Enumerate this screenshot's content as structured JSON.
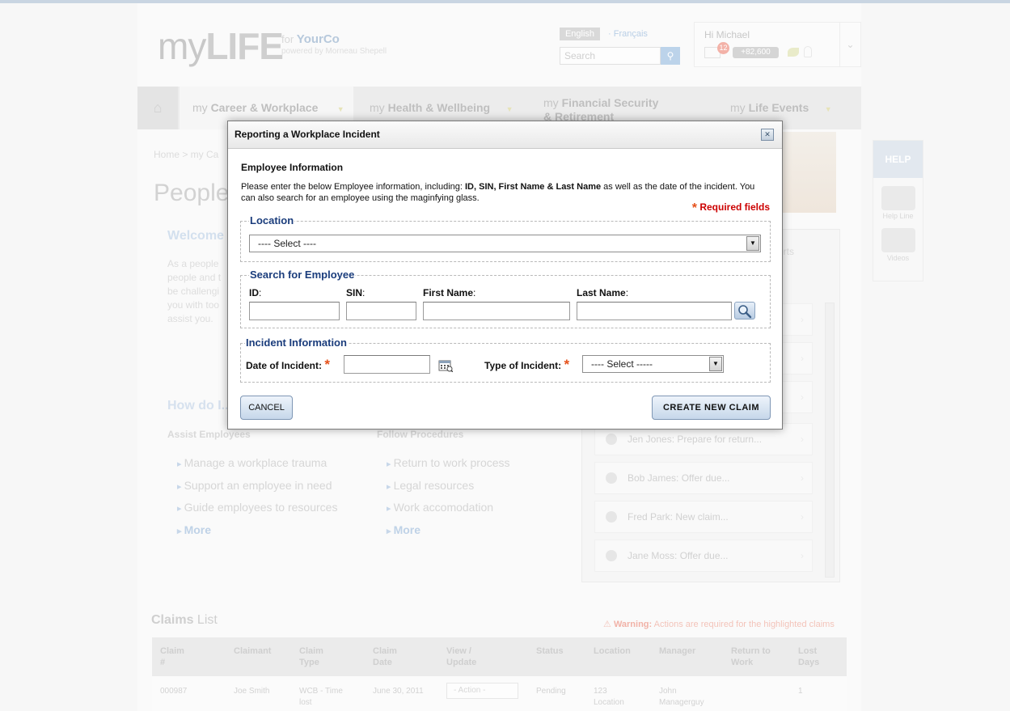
{
  "header": {
    "logo_my": "my",
    "logo_life": "LIFE",
    "logo_for": "for",
    "company": "YourCo",
    "powered_by": "powered by Morneau Shepell",
    "lang_en": "English",
    "lang_fr": "Français",
    "search_placeholder": "Search",
    "user_greeting": "Hi Michael",
    "notification_count": "12",
    "points": "+82,600"
  },
  "nav": {
    "tabs": [
      {
        "prefix": "my",
        "label": "Career & Workplace"
      },
      {
        "prefix": "my",
        "label": "Health & Wellbeing"
      },
      {
        "prefix": "my",
        "label": "Financial Security & Retirement"
      },
      {
        "prefix": "my",
        "label": "Life Events"
      }
    ]
  },
  "background": {
    "breadcrumb": "Home > my Ca",
    "page_title": "People",
    "welcome": "Welcome",
    "intro_lines": [
      "As a people",
      "people and t",
      "be challengi",
      "you with too",
      "assist you."
    ],
    "how_do": "How do I...",
    "assist_head": "Assist Employees",
    "assist_links": [
      "Manage a workplace trauma",
      "Support an employee in need",
      "Guide employees to resources"
    ],
    "procedure_head": "Follow Procedures",
    "procedure_links": [
      "Return to work process",
      "Legal resources",
      "Work accomodation"
    ],
    "more": "More",
    "help": "HELP",
    "help_line": "Help Line",
    "videos": "Videos",
    "cases_tab": "orts",
    "cases": [
      "Jen Jones: Prepare for return...",
      "Bob James: Offer due...",
      "Fred Park: New claim...",
      "Jane Moss: Offer due..."
    ]
  },
  "claims": {
    "title_bold": "Claims",
    "title_rest": "List",
    "warning_label": "Warning:",
    "warning_text": "Actions are required for the highlighted claims",
    "columns": [
      "Claim #",
      "Claimant",
      "Claim Type",
      "Claim Date",
      "View / Update",
      "Status",
      "Location",
      "Manager",
      "Return to Work",
      "Lost Days"
    ],
    "row": {
      "claim_no": "000987",
      "claimant": "Joe Smith",
      "type": "WCB - Time lost",
      "date": "June 30, 2011",
      "action": "- Action -",
      "status": "Pending",
      "location": "123 Location",
      "manager": "John Managerguy",
      "lost_days": "1"
    }
  },
  "dialog": {
    "title": "Reporting a Workplace Incident",
    "employee_heading": "Employee Information",
    "desc_before": "Please enter the below Employee information, including: ",
    "desc_bold": "ID, SIN, First Name & Last Name",
    "desc_after": " as well as the date of the incident. You can also search for an employee using the maginfying glass.",
    "required_note": "Required fields",
    "location_legend": "Location",
    "location_value": "---- Select ----",
    "search_legend": "Search for Employee",
    "label_id": "ID",
    "label_sin": "SIN",
    "label_first": "First Name",
    "label_last": "Last Name",
    "incident_legend": "Incident Information",
    "label_date": "Date of Incident:",
    "label_type": "Type of Incident:",
    "type_value": "---- Select -----",
    "cancel": "CANCEL",
    "create": "CREATE NEW CLAIM"
  },
  "colors": {
    "legend_blue": "#1b3d7c",
    "required_red": "#cc0000",
    "asterisk_orange": "#e5501a",
    "button_blue": "#c6d7ea"
  }
}
